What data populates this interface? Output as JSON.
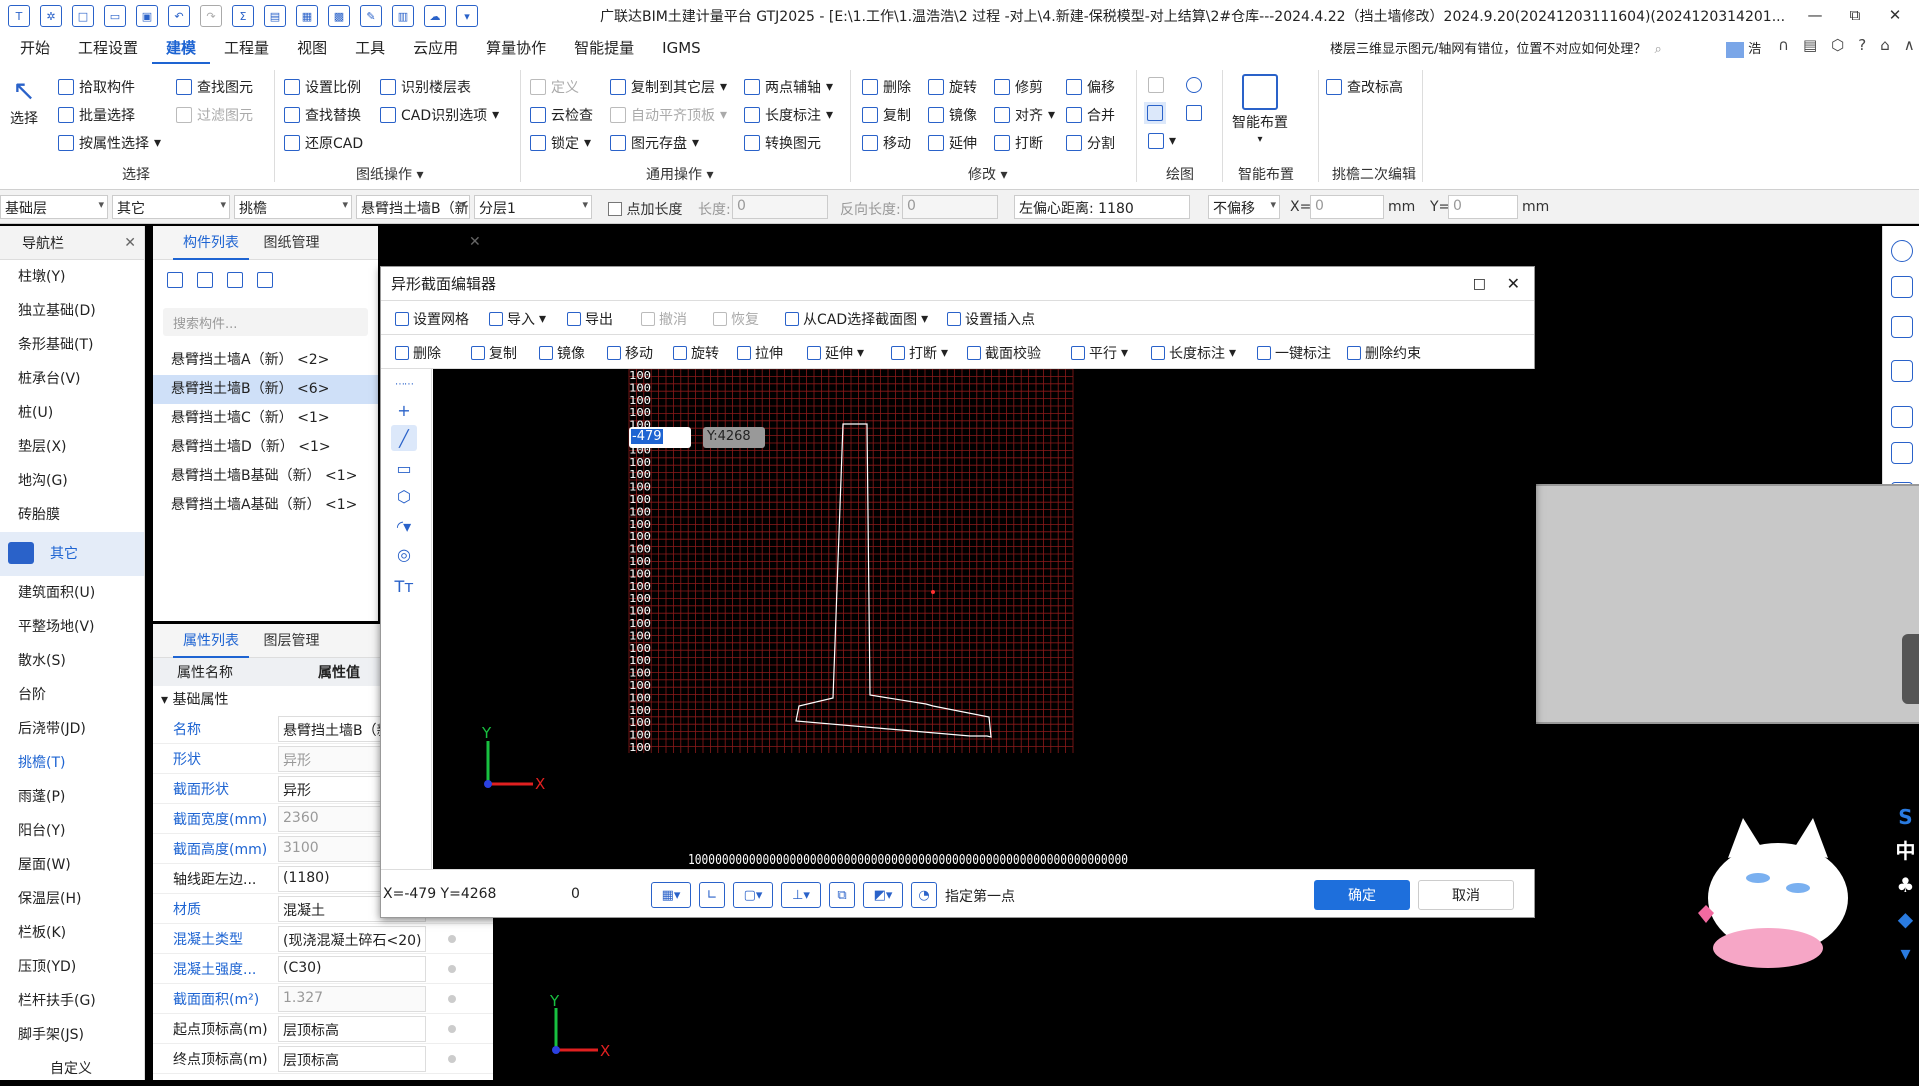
{
  "titlebar": {
    "title": "广联达BIM土建计量平台 GTJ2025 - [E:\\1.工作\\1.温浩浩\\2 过程 -对上\\4.新建-保税模型-对上结算\\2#仓库---2024.4.22（挡土墙修改）2024.9.20(20241203111604)(2024120314201...",
    "restore_icon": "⧉",
    "close_icon": "✕",
    "minimize_icon": "—"
  },
  "menubar": {
    "items": [
      "开始",
      "工程设置",
      "建模",
      "工程量",
      "视图",
      "工具",
      "云应用",
      "算量协作",
      "智能提量",
      "IGMS"
    ],
    "active_index": 2,
    "help_text": "楼层三维显示图元/轴网有错位，位置不对应如何处理？",
    "user_suffix": "浩",
    "help_icon": "?"
  },
  "ribbon": {
    "select": {
      "label": "选择",
      "pick": "拾取构件",
      "batch": "批量选择",
      "by_attr": "按属性选择",
      "find": "查找图元",
      "filter": "过滤图元",
      "group": "选择"
    },
    "drawing": {
      "scale": "设置比例",
      "find_replace": "查找替换",
      "restore_cad": "还原CAD",
      "floor_table": "识别楼层表",
      "cad_options": "CAD识别选项",
      "group": "图纸操作"
    },
    "common": {
      "define": "定义",
      "cloud_check": "云检查",
      "lock": "锁定",
      "copy_floor": "复制到其它层",
      "auto_align": "自动平齐顶板",
      "save_elem": "图元存盘",
      "two_point": "两点辅轴",
      "len_mark": "长度标注",
      "convert": "转换图元",
      "group": "通用操作"
    },
    "modify": {
      "delete": "删除",
      "copy": "复制",
      "move": "移动",
      "rotate": "旋转",
      "mirror": "镜像",
      "extend": "延伸",
      "trim": "修剪",
      "align": "对齐",
      "break": "打断",
      "offset": "偏移",
      "merge": "合并",
      "split": "分割",
      "group": "修改"
    },
    "draw": {
      "group": "绘图"
    },
    "smart": {
      "label": "智能布置",
      "group": "智能布置"
    },
    "cantilever": {
      "label": "查改标高",
      "group": "挑檐二次编辑"
    }
  },
  "proptoolbar": {
    "floor": "基础层",
    "category": "其它",
    "type": "挑檐",
    "component": "悬臂挡土墙B（新）",
    "layer": "分层1",
    "point_len_label": "点加长度",
    "length_label": "长度:",
    "length_value": "0",
    "rev_len_label": "反向长度:",
    "rev_len_value": "0",
    "left_offset": "左偏心距离: 1180",
    "offset_mode": "不偏移",
    "x_label": "X=",
    "x_value": "0",
    "y_label": "Y=",
    "y_value": "0",
    "unit": "mm"
  },
  "navpanel": {
    "title": "导航栏",
    "items": [
      "柱墩(Y)",
      "独立基础(D)",
      "条形基础(T)",
      "桩承台(V)",
      "桩(U)",
      "垫层(X)",
      "地沟(G)",
      "砖胎膜"
    ],
    "group": "其它",
    "items2": [
      "建筑面积(U)",
      "平整场地(V)",
      "散水(S)",
      "台阶",
      "后浇带(JD)",
      "挑檐(T)",
      "雨蓬(P)",
      "阳台(Y)",
      "屋面(W)",
      "保温层(H)",
      "栏板(K)",
      "压顶(YD)",
      "栏杆扶手(G)",
      "脚手架(JS)"
    ],
    "active_item2": 5,
    "bottom_item": "自定义"
  },
  "comppanel": {
    "tabs": [
      "构件列表",
      "图纸管理"
    ],
    "search_placeholder": "搜索构件...",
    "items": [
      "悬臂挡土墙A（新） <2>",
      "悬臂挡土墙B（新） <6>",
      "悬臂挡土墙C（新） <1>",
      "悬臂挡土墙D（新） <1>",
      "悬臂挡土墙B基础（新） <1>",
      "悬臂挡土墙A基础（新） <1>"
    ],
    "selected_index": 1
  },
  "attrpanel": {
    "tabs": [
      "属性列表",
      "图层管理"
    ],
    "col_name": "属性名称",
    "col_value": "属性值",
    "section": "基础属性",
    "rows": [
      {
        "name": "名称",
        "value": "悬臂挡土墙B（新）",
        "blue": true,
        "edit": true
      },
      {
        "name": "形状",
        "value": "异形",
        "blue": true,
        "edit": false
      },
      {
        "name": "截面形状",
        "value": "异形",
        "blue": true,
        "edit": true
      },
      {
        "name": "截面宽度(mm)",
        "value": "2360",
        "blue": true,
        "edit": false
      },
      {
        "name": "截面高度(mm)",
        "value": "3100",
        "blue": true,
        "edit": false
      },
      {
        "name": "轴线距左边...",
        "value": "(1180)",
        "blue": false,
        "edit": true
      },
      {
        "name": "材质",
        "value": "混凝土",
        "blue": true,
        "edit": true
      },
      {
        "name": "混凝土类型",
        "value": "(现浇混凝土碎石<20)",
        "blue": true,
        "edit": true
      },
      {
        "name": "混凝土强度...",
        "value": "(C30)",
        "blue": true,
        "edit": true
      },
      {
        "name": "截面面积(m²)",
        "value": "1.327",
        "blue": true,
        "edit": false
      },
      {
        "name": "起点顶标高(m)",
        "value": "层顶标高",
        "blue": false,
        "edit": true
      },
      {
        "name": "终点顶标高(m)",
        "value": "层顶标高",
        "blue": false,
        "edit": true
      }
    ]
  },
  "dialog": {
    "title": "异形截面编辑器",
    "toolbar1": {
      "grid": "设置网格",
      "import": "导入",
      "export": "导出",
      "undo": "撤消",
      "redo": "恢复",
      "from_cad": "从CAD选择截面图",
      "insert_pt": "设置插入点"
    },
    "toolbar2": {
      "delete": "删除",
      "copy": "复制",
      "mirror": "镜像",
      "move": "移动",
      "rotate": "旋转",
      "stretch": "拉伸",
      "extend": "延伸",
      "break": "打断",
      "check": "截面校验",
      "parallel": "平行",
      "len_mark": "长度标注",
      "one_key": "一键标注",
      "del_constraint": "删除约束"
    },
    "input_x": "-479",
    "input_y": "Y:4268",
    "coords": "X=-479 Y=4268",
    "angle": "0",
    "hint": "指定第一点",
    "ok": "确定",
    "cancel": "取消",
    "x_ruler": "10000000000000000000000000000000000000000000000000000000000000000",
    "y_ruler": [
      "100",
      "100",
      "100",
      "100",
      "100",
      "100",
      "100",
      "100",
      "100",
      "100",
      "100",
      "100",
      "100",
      "100",
      "100",
      "100",
      "100",
      "100",
      "100",
      "100",
      "100",
      "100",
      "100",
      "100",
      "100",
      "100",
      "100",
      "100",
      "100",
      "100",
      "100"
    ],
    "axis_x": "X",
    "axis_y": "Y"
  },
  "colors": {
    "accent": "#1e64d2",
    "grid": "#8b1a1a",
    "shape": "#ffffff"
  }
}
